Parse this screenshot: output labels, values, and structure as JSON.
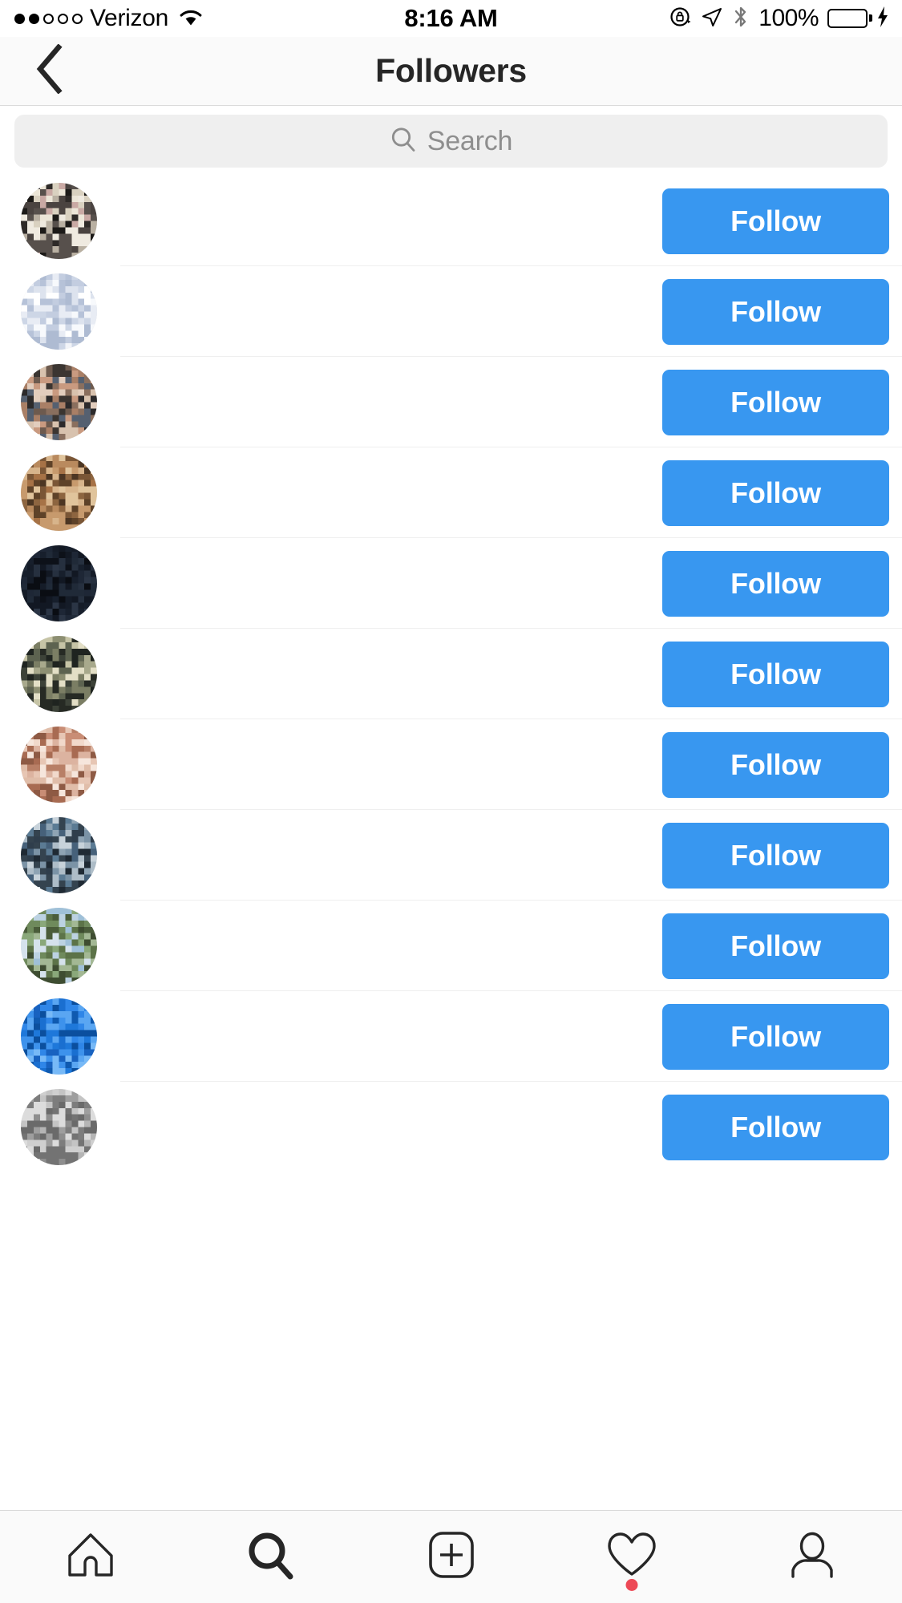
{
  "status_bar": {
    "carrier": "Verizon",
    "signal_dots_filled": 2,
    "signal_dots_total": 5,
    "wifi_icon": "wifi-icon",
    "time": "8:16 AM",
    "rotation_lock_icon": "rotation-lock-icon",
    "location_icon": "location-arrow-icon",
    "bluetooth_icon": "bluetooth-icon",
    "battery_percent": "100%",
    "battery_color": "#4CD662",
    "charging_icon": "charging-bolt-icon"
  },
  "header": {
    "back_icon": "chevron-left-icon",
    "title": "Followers"
  },
  "search": {
    "icon": "search-icon",
    "placeholder": "Search",
    "value": "",
    "background": "#EFEFEF",
    "text_color": "#8E8E8E"
  },
  "follow_button": {
    "label": "Follow",
    "background": "#3897F0",
    "text_color": "#FFFFFF"
  },
  "list": {
    "redacted": true,
    "note": "All usernames and full names are pixelated/blurred for privacy and are not legible.",
    "rows": [
      {
        "username": "",
        "fullname": "",
        "username_width": 295,
        "fullname_width": 265,
        "avatar_name": "avatar-dog-photo",
        "avatar_colors": [
          "#2e2a28",
          "#d9d1c0",
          "#ece6d8",
          "#4a4340",
          "#c9a9a4",
          "#1c1a18",
          "#b9b0a2",
          "#efeae0",
          "#57504c"
        ],
        "follow_label": "Follow"
      },
      {
        "username": "",
        "fullname": "",
        "username_width": 138,
        "fullname_width": 152,
        "avatar_name": "avatar-default-placeholder",
        "avatar_colors": [
          "#f2f4f8",
          "#c3cde0",
          "#dde3ee",
          "#ffffff",
          "#b6c2d8",
          "#e8ecf4",
          "#cdd6e6",
          "#f7f9fc",
          "#aebbd2"
        ],
        "follow_label": "Follow"
      },
      {
        "username": "",
        "fullname": "",
        "username_width": 158,
        "fullname_width": 168,
        "avatar_name": "avatar-portrait-photo",
        "avatar_colors": [
          "#6d5a4e",
          "#3b3531",
          "#c99a80",
          "#8a6f5e",
          "#e2cdbd",
          "#2c2a2b",
          "#a97f66",
          "#556070",
          "#d8c2ae"
        ],
        "follow_label": "Follow"
      },
      {
        "username": "",
        "fullname": "",
        "username_width": 255,
        "fullname_width": 210,
        "avatar_name": "avatar-brown-hair-photo",
        "avatar_colors": [
          "#7a5636",
          "#b98a5e",
          "#d7b48b",
          "#4c3623",
          "#a67246",
          "#e0c49c",
          "#8d6540",
          "#5e4228",
          "#c79a6d"
        ],
        "follow_label": "Follow"
      },
      {
        "username": "",
        "fullname": "",
        "username_width": 305,
        "fullname_width": 295,
        "avatar_name": "avatar-dark-navy-photo",
        "avatar_colors": [
          "#151c28",
          "#1e2736",
          "#0d1119",
          "#26303f",
          "#171f2c",
          "#0a0d13",
          "#202a38",
          "#121823",
          "#2b3545"
        ],
        "follow_label": "Follow"
      },
      {
        "username": "",
        "fullname": "",
        "username_width": 197,
        "fullname_width": 185,
        "avatar_name": "avatar-landscape-photo",
        "avatar_colors": [
          "#8d8f72",
          "#c6c4a6",
          "#5d6350",
          "#1f2420",
          "#a8a98c",
          "#e3dfc6",
          "#3c4238",
          "#7b7e64",
          "#262a24"
        ],
        "follow_label": "Follow"
      },
      {
        "username": "",
        "fullname": "",
        "username_width": 183,
        "fullname_width": 172,
        "avatar_name": "avatar-skin-tone-photo",
        "avatar_colors": [
          "#e7c6b4",
          "#c98d75",
          "#f1d9cb",
          "#a86b52",
          "#dcb3a0",
          "#f6e6dc",
          "#b87f66",
          "#e0bda9",
          "#8e5a44"
        ],
        "follow_label": "Follow"
      },
      {
        "username": "",
        "fullname": "",
        "username_width": 187,
        "fullname_width": 172,
        "avatar_name": "avatar-logo-photo",
        "avatar_colors": [
          "#5b7b94",
          "#8fa4b4",
          "#2f3e4c",
          "#c7d2da",
          "#46617a",
          "#1f2a34",
          "#7b93a6",
          "#aebdc8",
          "#34434f"
        ],
        "follow_label": "Follow"
      },
      {
        "username": "",
        "fullname": "",
        "username_width": 198,
        "fullname_width": 152,
        "avatar_name": "avatar-outdoor-photo",
        "avatar_colors": [
          "#9fc0d8",
          "#bcd2e2",
          "#6f8a5c",
          "#4a5c3a",
          "#8aa87a",
          "#d5e2ec",
          "#5c7348",
          "#a3b894",
          "#3e4d31"
        ],
        "follow_label": "Follow"
      },
      {
        "username": "",
        "fullname": "",
        "username_width": 218,
        "fullname_width": 255,
        "avatar_name": "avatar-blue-logo",
        "avatar_colors": [
          "#1a6fd0",
          "#2f86e8",
          "#0f5ab0",
          "#5aa6f2",
          "#1e78da",
          "#0b4f9e",
          "#3d92ec",
          "#1862c0",
          "#77b9f7"
        ],
        "follow_label": "Follow"
      },
      {
        "username": "",
        "fullname": "",
        "username_width": 228,
        "fullname_width": 205,
        "avatar_name": "avatar-gray-photo",
        "avatar_colors": [
          "#9e9e9e",
          "#c4c4c4",
          "#7d7d7d",
          "#dcdcdc",
          "#8e8e8e",
          "#6a6a6a",
          "#b5b5b5",
          "#cfcfcf",
          "#737373"
        ],
        "follow_label": "Follow"
      }
    ]
  },
  "tab_bar": {
    "tabs": [
      {
        "name": "home-tab",
        "icon": "home-icon",
        "active": false,
        "badge": false
      },
      {
        "name": "search-tab",
        "icon": "search-icon",
        "active": true,
        "badge": false
      },
      {
        "name": "add-post-tab",
        "icon": "plus-square-icon",
        "active": false,
        "badge": false
      },
      {
        "name": "activity-tab",
        "icon": "heart-icon",
        "active": false,
        "badge": true
      },
      {
        "name": "profile-tab",
        "icon": "person-icon",
        "active": false,
        "badge": false
      }
    ],
    "badge_color": "#ED4956"
  }
}
